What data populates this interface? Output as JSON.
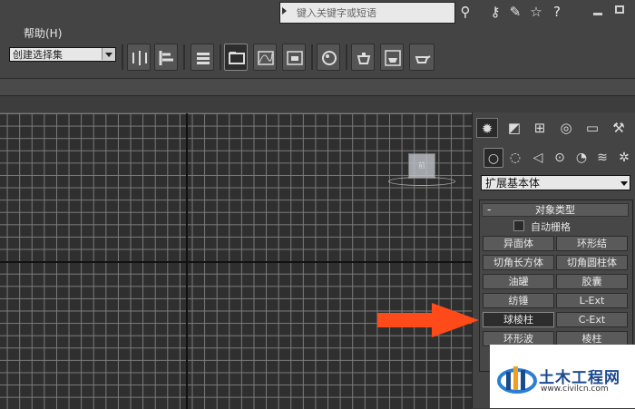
{
  "menu": {
    "help_label": "帮助(H)"
  },
  "search": {
    "placeholder": "键入关键字或短语"
  },
  "top_icons": [
    "binoculars-icon",
    "key-icon",
    "star-icon",
    "help-icon"
  ],
  "toolbar": {
    "selection_set_value": "创建选择集"
  },
  "command_panel": {
    "tabs": [
      "create-tab",
      "modify-tab",
      "hierarchy-tab",
      "motion-tab",
      "display-tab",
      "utilities-tab"
    ],
    "category_value": "扩展基本体",
    "rollout_title": "对象类型",
    "rollout_collapse": "-",
    "autogrid_label": "自动栅格",
    "buttons": [
      [
        "异面体",
        "环形结"
      ],
      [
        "切角长方体",
        "切角圆柱体"
      ],
      [
        "油罐",
        "胶囊"
      ],
      [
        "纺锤",
        "L-Ext"
      ],
      [
        "球棱柱",
        "C-Ext"
      ],
      [
        "环形波",
        "棱柱"
      ]
    ],
    "selected_button": "球棱柱"
  },
  "viewport": {
    "viewcube_label": "前"
  },
  "watermark": {
    "title": "土木工程网",
    "url": "www.civilcn.com"
  },
  "colors": {
    "annotation_arrow": "#ff4a1a",
    "watermark_blue": "#1c4a8d"
  }
}
